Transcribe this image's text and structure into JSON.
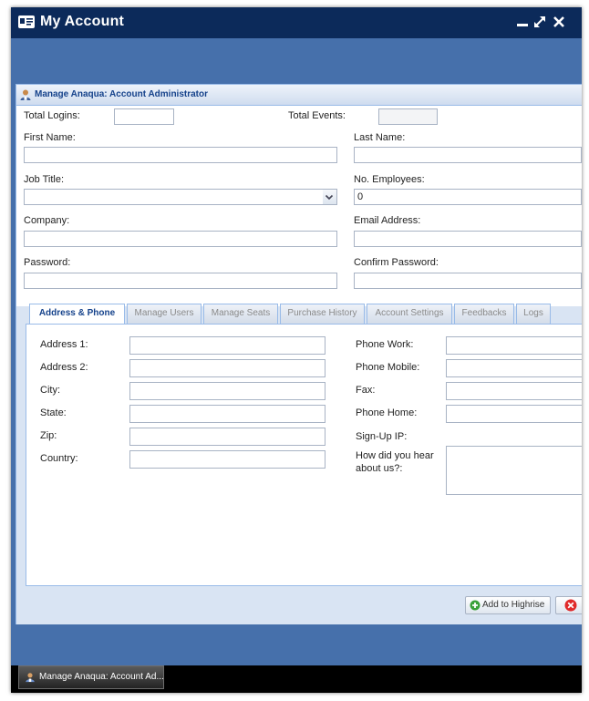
{
  "window": {
    "title": "My Account",
    "icon": "id-card-icon",
    "controls": [
      "minimize-icon",
      "maximize-icon",
      "close-icon"
    ]
  },
  "panel": {
    "title": "Manage Anaqua: Account Administrator",
    "icon": "user-admin-icon"
  },
  "form": {
    "total_logins_label": "Total Logins:",
    "total_logins_value": "",
    "total_events_label": "Total Events:",
    "total_events_value": "",
    "first_name_label": "First Name:",
    "first_name_value": "",
    "last_name_label": "Last Name:",
    "last_name_value": "",
    "job_title_label": "Job Title:",
    "job_title_value": "",
    "no_employees_label": "No. Employees:",
    "no_employees_value": "0",
    "company_label": "Company:",
    "company_value": "",
    "email_label": "Email Address:",
    "email_value": "",
    "password_label": "Password:",
    "password_value": "",
    "confirm_password_label": "Confirm Password:",
    "confirm_password_value": ""
  },
  "tabs": [
    {
      "label": "Address & Phone",
      "active": true
    },
    {
      "label": "Manage Users",
      "active": false
    },
    {
      "label": "Manage Seats",
      "active": false
    },
    {
      "label": "Purchase History",
      "active": false
    },
    {
      "label": "Account Settings",
      "active": false
    },
    {
      "label": "Feedbacks",
      "active": false
    },
    {
      "label": "Logs",
      "active": false
    }
  ],
  "address": {
    "address1_label": "Address 1:",
    "address2_label": "Address 2:",
    "city_label": "City:",
    "state_label": "State:",
    "zip_label": "Zip:",
    "country_label": "Country:",
    "phone_work_label": "Phone Work:",
    "phone_mobile_label": "Phone Mobile:",
    "fax_label": "Fax:",
    "phone_home_label": "Phone Home:",
    "signup_ip_label": "Sign-Up IP:",
    "signup_ip_value": "",
    "hear_about_label_line1": "How did you hear",
    "hear_about_label_line2": "about us?:"
  },
  "footer": {
    "add_highrise_label": "Add to Highrise",
    "add_icon": "add-circle-icon",
    "cancel_icon": "cancel-icon"
  },
  "taskbar": {
    "item_label": "Manage Anaqua: Account Ad..."
  },
  "colors": {
    "titlebar": "#0c2a5a",
    "window_bg": "#4670ab",
    "panel_bg": "#d9e4f3",
    "tab_text_active": "#15428b",
    "add_green": "#3aa13a",
    "cancel_red": "#e02a2a"
  }
}
